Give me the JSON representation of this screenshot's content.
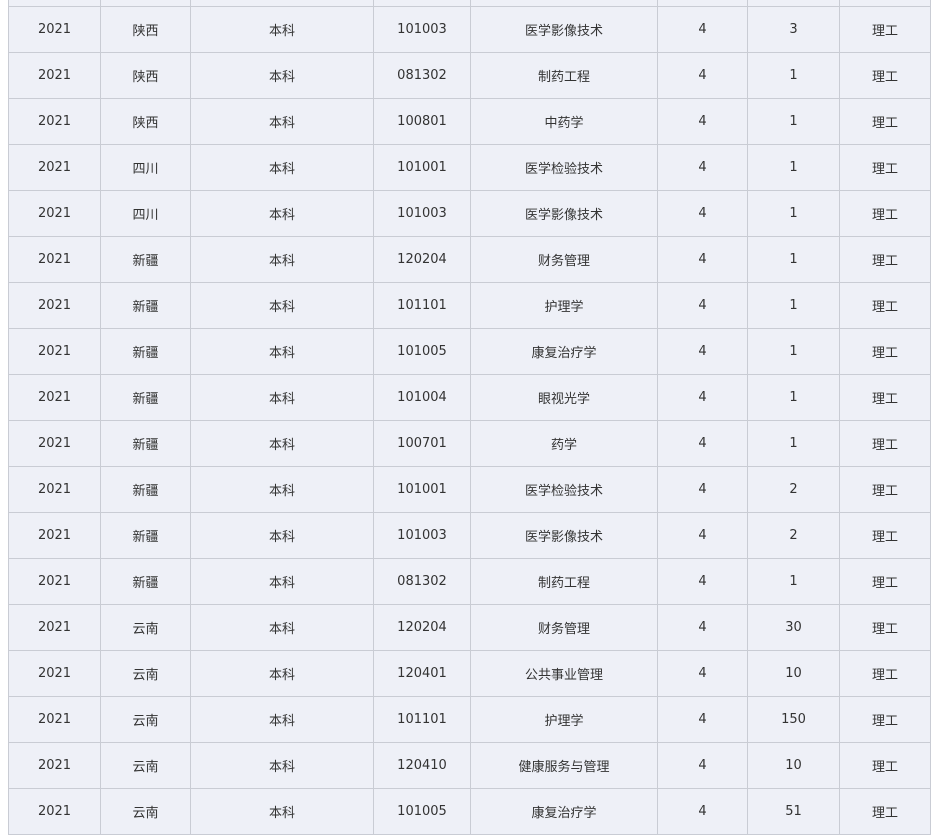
{
  "table": {
    "rows": [
      [
        "2021",
        "陕西",
        "本科",
        "101003",
        "医学影像技术",
        "4",
        "3",
        "理工"
      ],
      [
        "2021",
        "陕西",
        "本科",
        "081302",
        "制药工程",
        "4",
        "1",
        "理工"
      ],
      [
        "2021",
        "陕西",
        "本科",
        "100801",
        "中药学",
        "4",
        "1",
        "理工"
      ],
      [
        "2021",
        "四川",
        "本科",
        "101001",
        "医学检验技术",
        "4",
        "1",
        "理工"
      ],
      [
        "2021",
        "四川",
        "本科",
        "101003",
        "医学影像技术",
        "4",
        "1",
        "理工"
      ],
      [
        "2021",
        "新疆",
        "本科",
        "120204",
        "财务管理",
        "4",
        "1",
        "理工"
      ],
      [
        "2021",
        "新疆",
        "本科",
        "101101",
        "护理学",
        "4",
        "1",
        "理工"
      ],
      [
        "2021",
        "新疆",
        "本科",
        "101005",
        "康复治疗学",
        "4",
        "1",
        "理工"
      ],
      [
        "2021",
        "新疆",
        "本科",
        "101004",
        "眼视光学",
        "4",
        "1",
        "理工"
      ],
      [
        "2021",
        "新疆",
        "本科",
        "100701",
        "药学",
        "4",
        "1",
        "理工"
      ],
      [
        "2021",
        "新疆",
        "本科",
        "101001",
        "医学检验技术",
        "4",
        "2",
        "理工"
      ],
      [
        "2021",
        "新疆",
        "本科",
        "101003",
        "医学影像技术",
        "4",
        "2",
        "理工"
      ],
      [
        "2021",
        "新疆",
        "本科",
        "081302",
        "制药工程",
        "4",
        "1",
        "理工"
      ],
      [
        "2021",
        "云南",
        "本科",
        "120204",
        "财务管理",
        "4",
        "30",
        "理工"
      ],
      [
        "2021",
        "云南",
        "本科",
        "120401",
        "公共事业管理",
        "4",
        "10",
        "理工"
      ],
      [
        "2021",
        "云南",
        "本科",
        "101101",
        "护理学",
        "4",
        "150",
        "理工"
      ],
      [
        "2021",
        "云南",
        "本科",
        "120410",
        "健康服务与管理",
        "4",
        "10",
        "理工"
      ],
      [
        "2021",
        "云南",
        "本科",
        "101005",
        "康复治疗学",
        "4",
        "51",
        "理工"
      ]
    ]
  },
  "colors": {
    "row_background": "#eef0f7",
    "border": "#c9ccd4",
    "text": "#333333"
  }
}
